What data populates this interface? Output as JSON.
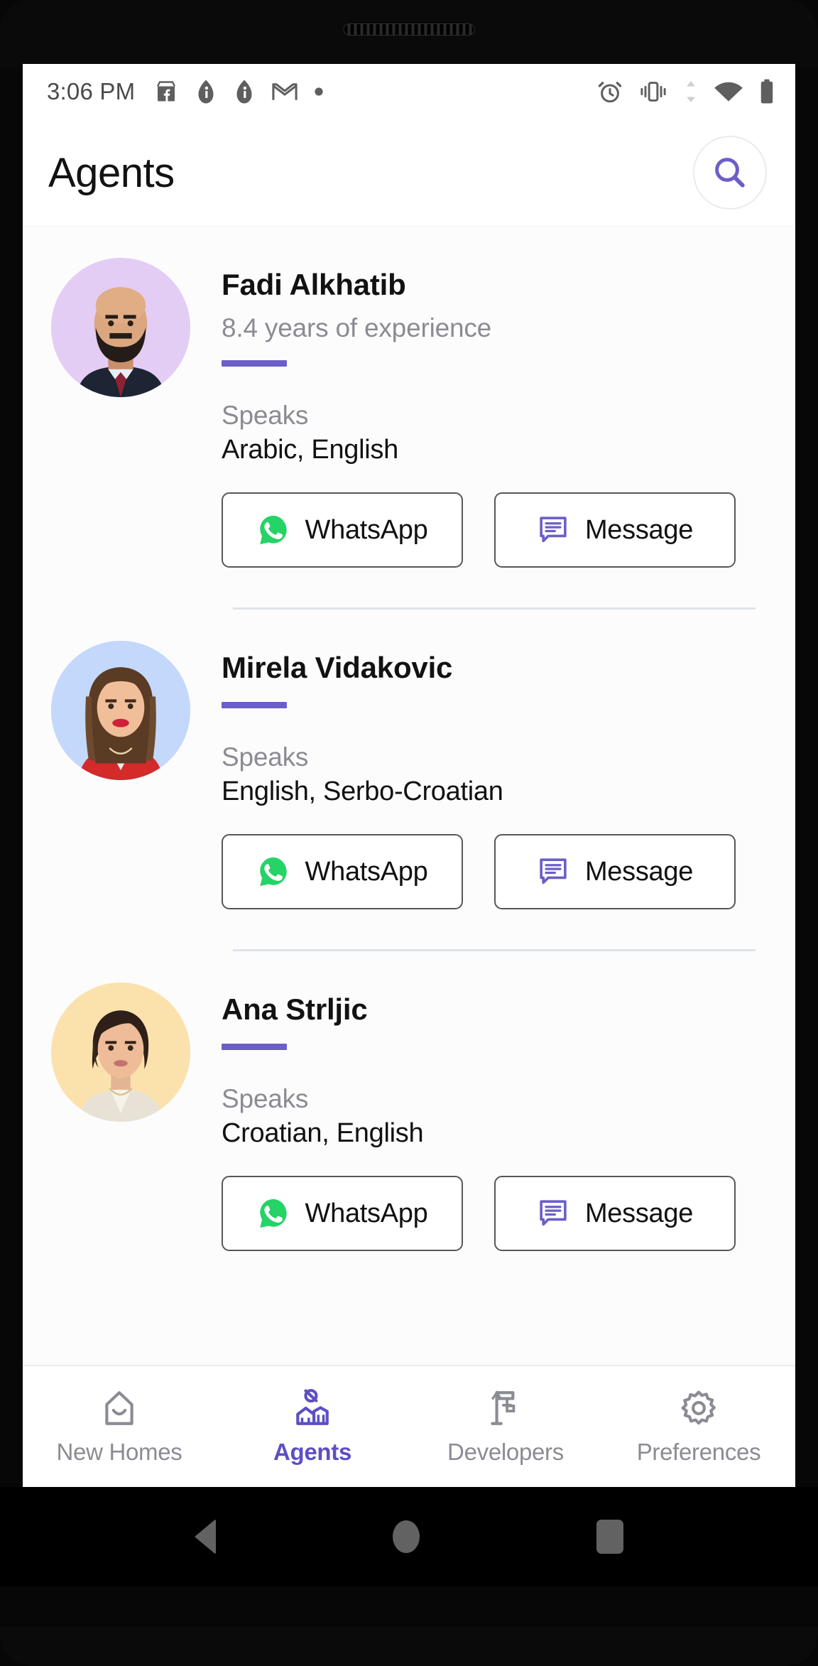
{
  "status_bar": {
    "time": "3:06 PM",
    "left_icons": [
      "facebook-marketplace-icon",
      "teardrop-icon",
      "teardrop-icon",
      "gmail-icon",
      "dot-icon"
    ],
    "right_icons": [
      "alarm-icon",
      "vibrate-icon",
      "data-transfer-icon",
      "wifi-icon",
      "battery-icon"
    ]
  },
  "header": {
    "title": "Agents",
    "search_icon": "search-icon"
  },
  "theme": {
    "accent": "#6b5fc7",
    "accent_text": "#5c4fc4",
    "whatsapp_green": "#25D366",
    "muted_text": "#8b8b93",
    "divider": "#dfe3ea",
    "list_bg": "#fcfcfd"
  },
  "agents": [
    {
      "name": "Fadi Alkhatib",
      "experience": "8.4 years of experience",
      "speaks_label": "Speaks",
      "languages": "Arabic, English",
      "avatar_bg": "#e4cdf5",
      "whatsapp_label": "WhatsApp",
      "message_label": "Message"
    },
    {
      "name": "Mirela Vidakovic",
      "experience": "",
      "speaks_label": "Speaks",
      "languages": "English, Serbo-Croatian",
      "avatar_bg": "#c3d8fb",
      "whatsapp_label": "WhatsApp",
      "message_label": "Message"
    },
    {
      "name": "Ana Strljic",
      "experience": "",
      "speaks_label": "Speaks",
      "languages": "Croatian, English",
      "avatar_bg": "#fbe2ad",
      "whatsapp_label": "WhatsApp",
      "message_label": "Message"
    }
  ],
  "bottom_nav": {
    "tabs": [
      {
        "label": "New Homes",
        "icon": "home-icon",
        "active": false
      },
      {
        "label": "Agents",
        "icon": "agent-icon",
        "active": true
      },
      {
        "label": "Developers",
        "icon": "crane-icon",
        "active": false
      },
      {
        "label": "Preferences",
        "icon": "gear-icon",
        "active": false
      }
    ]
  },
  "android_nav": {
    "back": "back-icon",
    "home": "home-circle-icon",
    "recents": "recents-square-icon"
  }
}
